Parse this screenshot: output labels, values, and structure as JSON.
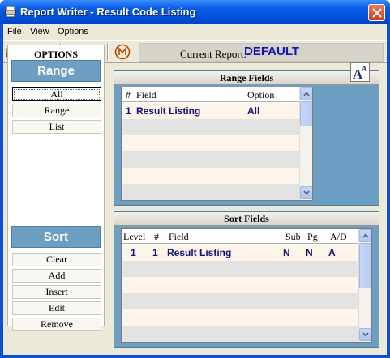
{
  "window": {
    "title": "Report Writer - Result Code Listing"
  },
  "menu": {
    "items": [
      "File",
      "View",
      "Options"
    ]
  },
  "toolbar": {
    "buttons": [
      "open-folder-icon",
      "save-icon",
      "delete-icon",
      "print-preview-icon",
      "print-icon",
      "report-icon"
    ],
    "current_report_label": "Current Report:",
    "current_report_value": "DEFAULT"
  },
  "options": {
    "title": "OPTIONS",
    "range_label": "Range",
    "range_buttons": [
      "All",
      "Range",
      "List"
    ],
    "sort_label": "Sort",
    "sort_buttons": [
      "Clear",
      "Add",
      "Insert",
      "Edit",
      "Remove"
    ]
  },
  "range_fields": {
    "title": "Range Fields",
    "headers": {
      "num": "#",
      "field": "Field",
      "option": "Option"
    },
    "rows": [
      {
        "num": "1",
        "field": "Result Listing",
        "option": "All"
      }
    ]
  },
  "sort_fields": {
    "title": "Sort Fields",
    "headers": {
      "level": "Level",
      "num": "#",
      "field": "Field",
      "sub": "Sub",
      "pg": "Pg",
      "ad": "A/D"
    },
    "rows": [
      {
        "level": "1",
        "num": "1",
        "field": "Result Listing",
        "sub": "N",
        "pg": "N",
        "ad": "A"
      }
    ]
  },
  "font_button": {
    "glyph_large": "A",
    "glyph_small": "A"
  },
  "colors": {
    "title_bar": "#0a5ce8",
    "panel_blue": "#6d9fc2",
    "report_value": "#1414b4",
    "row_text": "#14147a"
  }
}
